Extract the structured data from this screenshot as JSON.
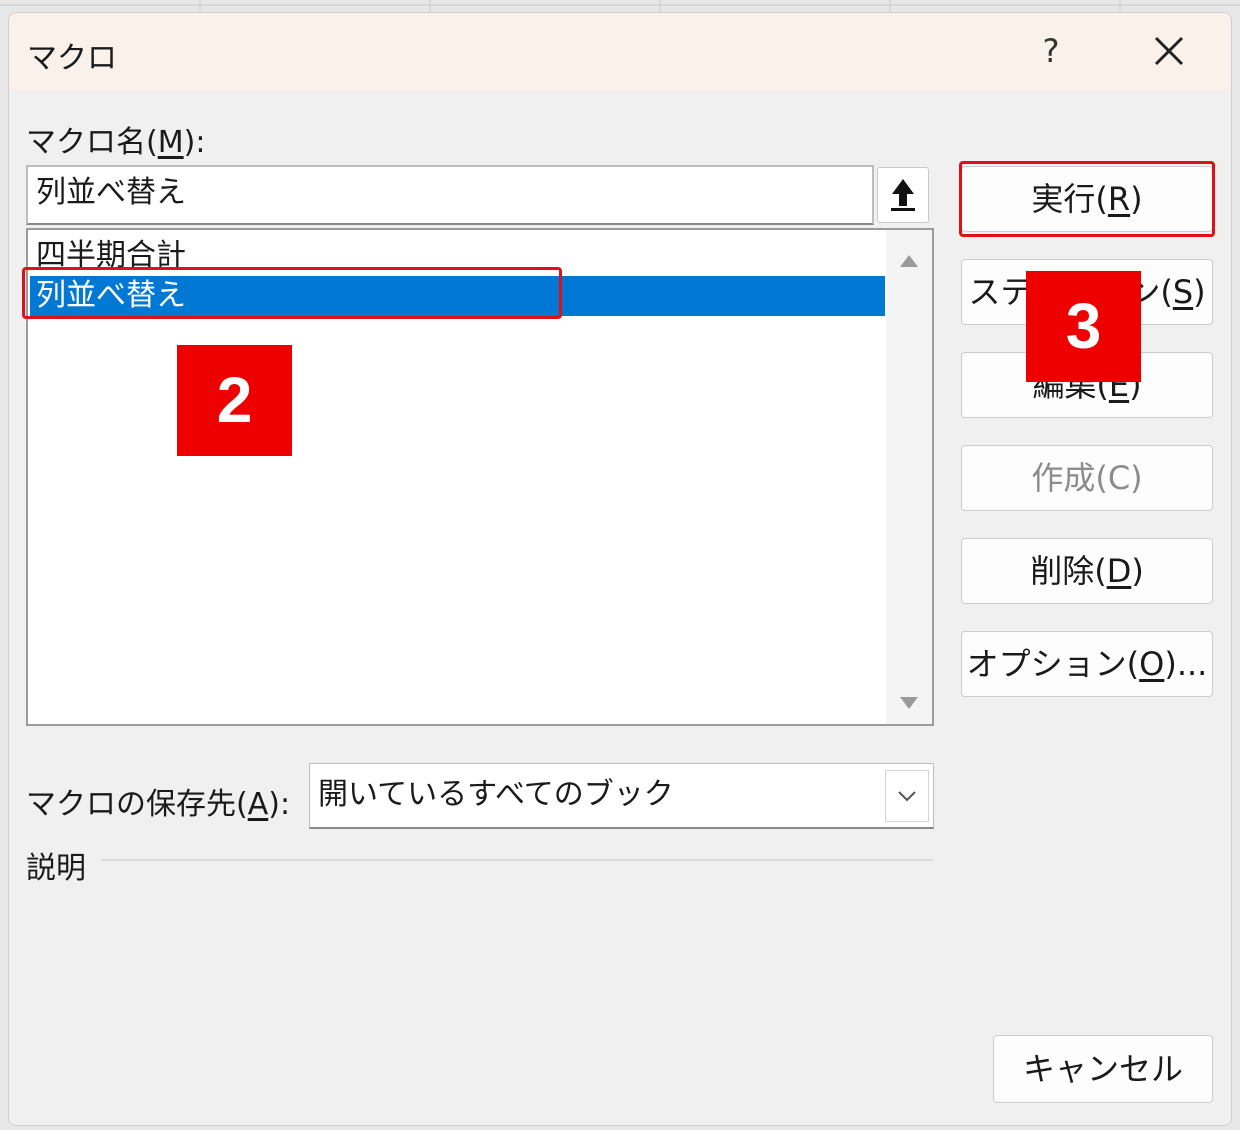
{
  "dialog": {
    "title": "マクロ",
    "help": "?",
    "macro_name_label": {
      "before": "マクロ名(",
      "key": "M",
      "after": "):"
    },
    "macro_name_value": "列並べ替え",
    "macro_list": [
      "四半期合計",
      "列並べ替え"
    ],
    "selected_index": 1,
    "buttons": {
      "run": {
        "before": "実行(",
        "key": "R",
        "after": ")"
      },
      "step": {
        "before": "ステップイン(",
        "key": "S",
        "after": ")"
      },
      "edit": {
        "before": "編集(",
        "key": "E",
        "after": ")"
      },
      "create": "作成(C)",
      "delete": {
        "before": "削除(",
        "key": "D",
        "after": ")"
      },
      "options": {
        "before": "オプション(",
        "key": "O",
        "after": ")..."
      },
      "cancel": "キャンセル"
    },
    "save_in_label": {
      "before": "マクロの保存先(",
      "key": "A",
      "after": "):"
    },
    "save_in_value": "開いているすべてのブック",
    "description_label": "説明"
  },
  "annotations": {
    "badge_2": "2",
    "badge_3": "3",
    "highlight_color": "#e0101a"
  }
}
